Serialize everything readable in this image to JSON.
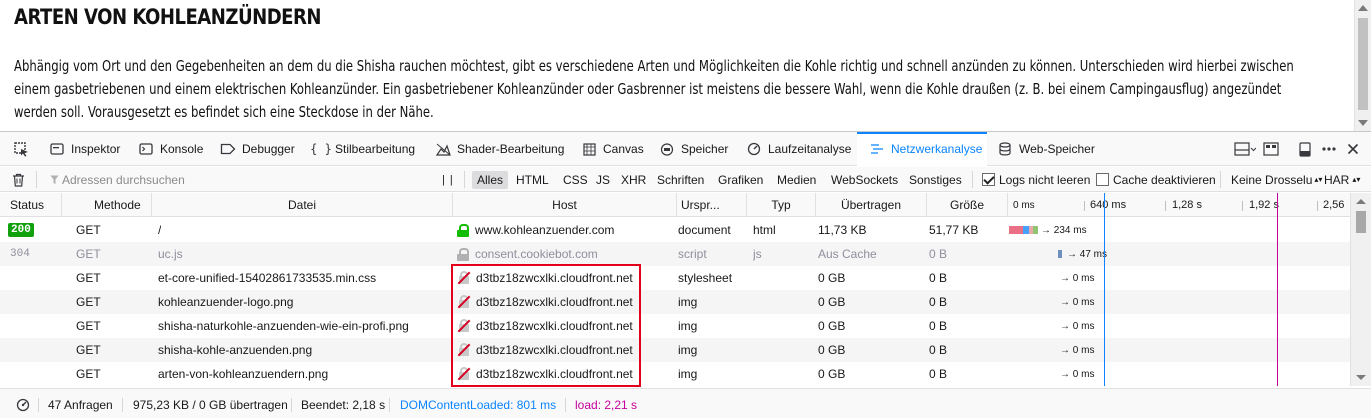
{
  "page": {
    "heading": "ARTEN VON KOHLEANZÜNDERN",
    "paragraph": "Abhängig vom Ort und den Gegebenheiten an dem du die Shisha rauchen möchtest, gibt es verschiedene Arten und Möglichkeiten die Kohle richtig und schnell anzünden zu können. Unterschieden wird hierbei zwischen einem gasbetriebenen und einem elektrischen Kohleanzünder. Ein gasbetriebener Kohleanzünder oder Gasbrenner ist meistens die bessere Wahl, wenn die Kohle draußen (z. B. bei einem Campingausflug) angezündet werden soll. Vorausgesetzt es befindet sich eine Steckdose in der Nähe."
  },
  "devtools": {
    "tabs": [
      {
        "label": "Inspektor",
        "icon": "inspector-icon"
      },
      {
        "label": "Konsole",
        "icon": "console-icon"
      },
      {
        "label": "Debugger",
        "icon": "debugger-icon"
      },
      {
        "label": "Stilbearbeitung",
        "icon": "braces-icon"
      },
      {
        "label": "Shader-Bearbeitung",
        "icon": "shader-icon"
      },
      {
        "label": "Canvas",
        "icon": "canvas-icon"
      },
      {
        "label": "Speicher",
        "icon": "memory-icon"
      },
      {
        "label": "Laufzeitanalyse",
        "icon": "performance-icon"
      },
      {
        "label": "Netzwerkanalyse",
        "icon": "network-icon",
        "active": true
      },
      {
        "label": "Web-Speicher",
        "icon": "storage-icon"
      }
    ],
    "toolbar": {
      "filter_placeholder": "Adressen durchsuchen",
      "pause": "| |",
      "types": [
        "Alles",
        "HTML",
        "CSS",
        "JS",
        "XHR",
        "Schriften",
        "Grafiken",
        "Medien",
        "WebSockets",
        "Sonstiges"
      ],
      "active_type": "Alles",
      "persist_logs": "Logs nicht leeren",
      "persist_logs_checked": true,
      "disable_cache": "Cache deaktivieren",
      "disable_cache_checked": false,
      "throttle": "Keine Drosselu",
      "har": "HAR"
    },
    "columns": {
      "status": "Status",
      "method": "Methode",
      "file": "Datei",
      "host": "Host",
      "cause": "Urspr...",
      "type": "Typ",
      "transferred": "Übertragen",
      "size": "Größe"
    },
    "timeline_ticks": [
      "0 ms",
      "640 ms",
      "1,28 s",
      "1,92 s",
      "2,56"
    ],
    "rows": [
      {
        "status": "200",
        "method": "GET",
        "file": "/",
        "host": "www.kohleanzuender.com",
        "cause": "document",
        "type": "html",
        "transferred": "11,73 KB",
        "size": "51,77 KB",
        "timing": "→ 234 ms"
      },
      {
        "status": "304",
        "method": "GET",
        "file": "uc.js",
        "host": "consent.cookiebot.com",
        "cause": "script",
        "type": "js",
        "transferred": "Aus Cache",
        "size": "0 B",
        "timing": "→ 47 ms"
      },
      {
        "status": "",
        "method": "GET",
        "file": "et-core-unified-15402861733535.min.css",
        "host": "d3tbz18zwcxlki.cloudfront.net",
        "cause": "stylesheet",
        "type": "",
        "transferred": "0 GB",
        "size": "0 B",
        "timing": "→ 0 ms"
      },
      {
        "status": "",
        "method": "GET",
        "file": "kohleanzuender-logo.png",
        "host": "d3tbz18zwcxlki.cloudfront.net",
        "cause": "img",
        "type": "",
        "transferred": "0 GB",
        "size": "0 B",
        "timing": "→ 0 ms"
      },
      {
        "status": "",
        "method": "GET",
        "file": "shisha-naturkohle-anzuenden-wie-ein-profi.png",
        "host": "d3tbz18zwcxlki.cloudfront.net",
        "cause": "img",
        "type": "",
        "transferred": "0 GB",
        "size": "0 B",
        "timing": "→ 0 ms"
      },
      {
        "status": "",
        "method": "GET",
        "file": "shisha-kohle-anzuenden.png",
        "host": "d3tbz18zwcxlki.cloudfront.net",
        "cause": "img",
        "type": "",
        "transferred": "0 GB",
        "size": "0 B",
        "timing": "→ 0 ms"
      },
      {
        "status": "",
        "method": "GET",
        "file": "arten-von-kohleanzuendern.png",
        "host": "d3tbz18zwcxlki.cloudfront.net",
        "cause": "img",
        "type": "",
        "transferred": "0 GB",
        "size": "0 B",
        "timing": "→ 0 ms"
      }
    ],
    "statusbar": {
      "requests": "47 Anfragen",
      "transferred": "975,23 KB / 0 GB übertragen",
      "finished": "Beendet: 2,18 s",
      "dom_content_loaded": "DOMContentLoaded: 801 ms",
      "load": "load: 2,21 s"
    },
    "colors": {
      "accent": "#0a84ff",
      "status_ok": "#12a10e",
      "highlight_box": "#e3001b",
      "load_line": "#c5009b"
    }
  }
}
